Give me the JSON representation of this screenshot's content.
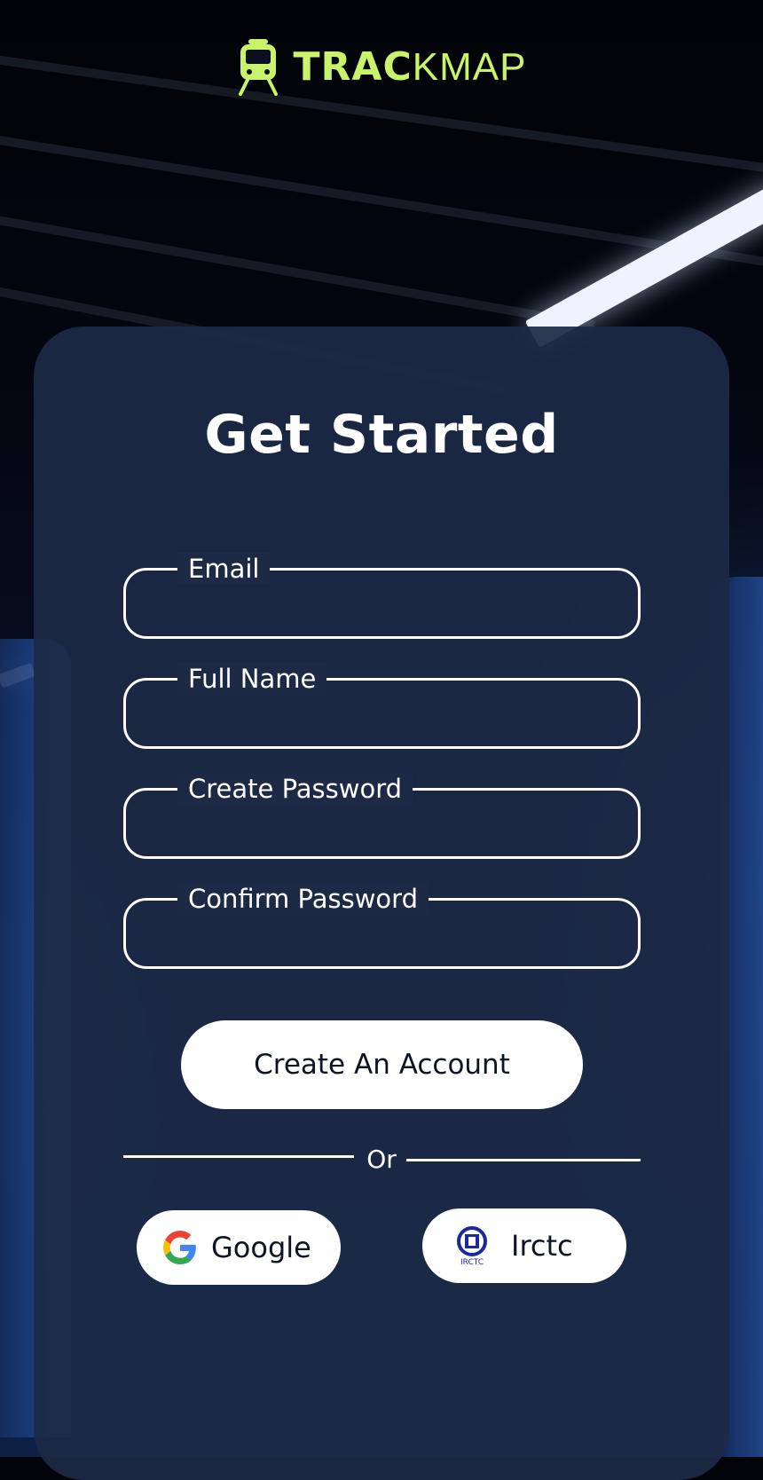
{
  "brand": {
    "logo_part1": "TRAC",
    "logo_part2": "KMAP",
    "accent_color": "#c8f36a"
  },
  "form": {
    "title": "Get Started",
    "fields": [
      {
        "label": "Email",
        "value": ""
      },
      {
        "label": "Full Name",
        "value": ""
      },
      {
        "label": "Create Password",
        "value": ""
      },
      {
        "label": "Confirm Password",
        "value": ""
      }
    ],
    "submit_label": "Create An Account",
    "divider_text": "Or"
  },
  "social": {
    "google_label": "Google",
    "google_icon": "google-g-icon",
    "irctc_label": "Irctc",
    "irctc_icon": "irctc-logo-icon",
    "irctc_logo_text": "IRCTC"
  },
  "colors": {
    "card_bg": "#1c2a46",
    "button_bg": "#ffffff",
    "text": "#ffffff"
  }
}
